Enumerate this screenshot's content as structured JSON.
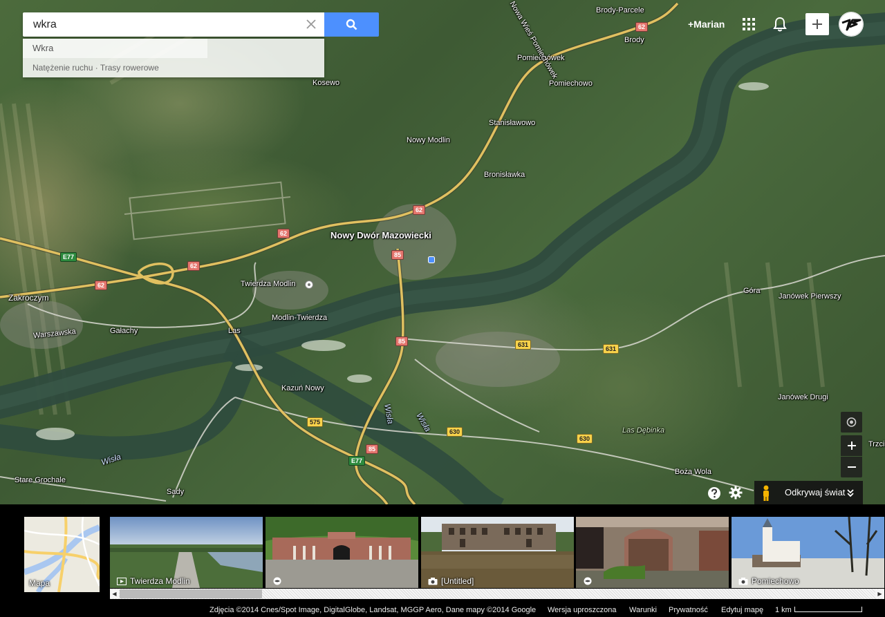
{
  "search": {
    "value": "wkra",
    "suggestions": [
      "Wkra",
      "Natężenie ruchu · Trasy rowerowe"
    ]
  },
  "header": {
    "user": "+Marian"
  },
  "map": {
    "places": [
      {
        "name": "Brody-Parcele"
      },
      {
        "name": "Brody"
      },
      {
        "name": "Pomiechówek"
      },
      {
        "name": "Pomiechowo"
      },
      {
        "name": "Kosewo"
      },
      {
        "name": "Stanisławowo"
      },
      {
        "name": "Nowy Modlin"
      },
      {
        "name": "Bronisławka"
      },
      {
        "name": "Nowy Dwór Mazowiecki"
      },
      {
        "name": "Twierdza Modlin"
      },
      {
        "name": "Zakroczym"
      },
      {
        "name": "Modlin-Twierdza"
      },
      {
        "name": "Warszawska"
      },
      {
        "name": "Gałachy"
      },
      {
        "name": "Las"
      },
      {
        "name": "Kazuń Nowy"
      },
      {
        "name": "Wisła"
      },
      {
        "name": "Wisła"
      },
      {
        "name": "Wisła"
      },
      {
        "name": "Góra"
      },
      {
        "name": "Janówek Pierwszy"
      },
      {
        "name": "Janówek Drugi"
      },
      {
        "name": "Las Dębinka"
      },
      {
        "name": "Boża Wola"
      },
      {
        "name": "Trzci"
      },
      {
        "name": "Stare Grochale"
      },
      {
        "name": "Sady"
      },
      {
        "name": "Nowa Wieś Pomiechówek"
      }
    ],
    "shields": [
      "62",
      "62",
      "62",
      "62",
      "62",
      "85",
      "85",
      "85",
      "631",
      "631",
      "575",
      "630",
      "630",
      "E77",
      "E77"
    ]
  },
  "controls": {
    "explore_label": "Odkrywaj świat"
  },
  "strip": {
    "map_thumb_label": "Mapa",
    "photos": [
      {
        "caption": "Twierdza Modlin",
        "icon": "video-icon"
      },
      {
        "caption": "",
        "icon": "panorama-icon"
      },
      {
        "caption": "[Untitled]",
        "icon": "camera-icon"
      },
      {
        "caption": "",
        "icon": "panorama-icon"
      },
      {
        "caption": "Pomiechowo",
        "icon": "camera-icon"
      }
    ]
  },
  "footer": {
    "attribution": "Zdjęcia ©2014 Cnes/Spot Image, DigitalGlobe, Landsat, MGGP Aero, Dane mapy ©2014 Google",
    "lite_version": "Wersja uproszczona",
    "terms": "Warunki",
    "privacy": "Prywatność",
    "edit_map": "Edytuj mapę",
    "scale": "1 km"
  },
  "colors": {
    "search_blue": "#4d90fe",
    "road_yellow": "#e0c060",
    "river": "#2f4b3e"
  }
}
